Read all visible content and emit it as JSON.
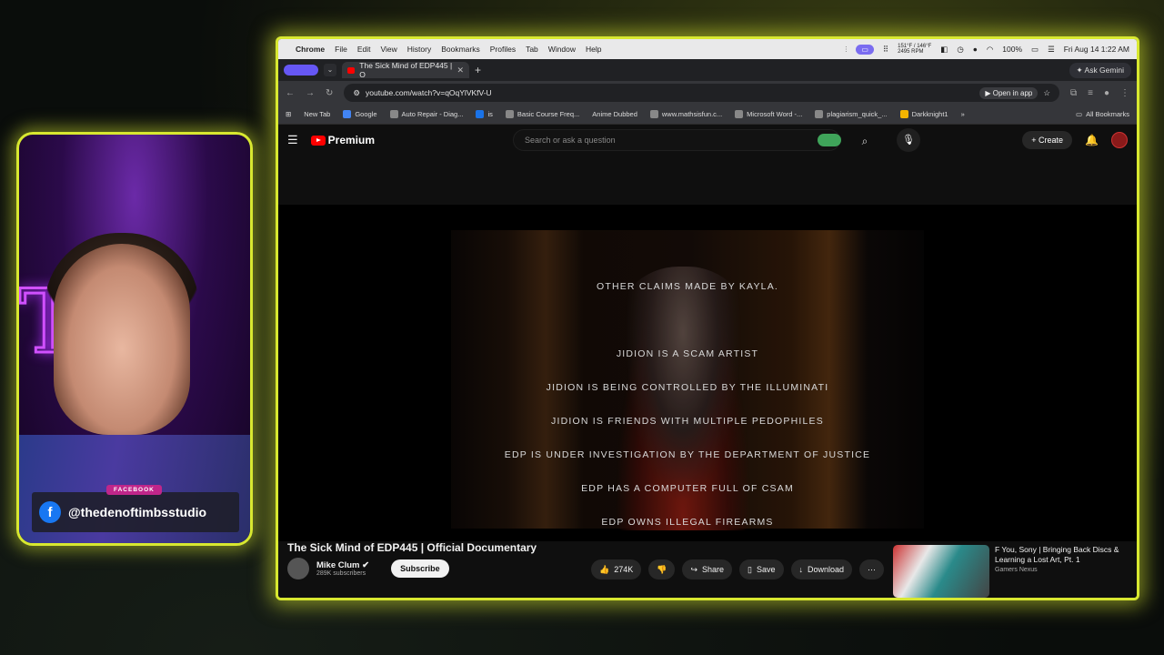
{
  "mac_menu": {
    "app": "Chrome",
    "items": [
      "File",
      "Edit",
      "View",
      "History",
      "Bookmarks",
      "Profiles",
      "Tab",
      "Window",
      "Help"
    ],
    "stats_top": "151°F / 146°F",
    "stats_bottom": "2495 RPM",
    "battery": "100%",
    "datetime": "Fri Aug 14  1:22 AM"
  },
  "tabs": {
    "active_title": "The Sick Mind of EDP445 | O",
    "ask_gemini": "Ask Gemini"
  },
  "address": {
    "url": "youtube.com/watch?v=qOqYlVKfV-U",
    "open_in_app": "Open in app"
  },
  "bookmarks": {
    "items": [
      "New Tab",
      "Google",
      "Auto Repair - Diag...",
      "is",
      "Basic Course Freq...",
      "Anime Dubbed",
      "www.mathsisfun.c...",
      "Microsoft Word -...",
      "plagiarism_quick_...",
      "Darkknight1"
    ],
    "all_label": "All Bookmarks"
  },
  "youtube": {
    "logo_text": "Premium",
    "search_placeholder": "Search or ask a question",
    "create_label": "Create"
  },
  "video": {
    "heading": "OTHER CLAIMS MADE BY KAYLA.",
    "claims": [
      "JIDION IS A SCAM ARTIST",
      "JIDION IS BEING CONTROLLED BY THE ILLUMINATI",
      "JIDION IS FRIENDS WITH MULTIPLE PEDOPHILES",
      "EDP IS UNDER INVESTIGATION BY THE DEPARTMENT OF JUSTICE",
      "EDP HAS A COMPUTER FULL OF CSAM",
      "EDP OWNS ILLEGAL FIREARMS"
    ],
    "title": "The Sick Mind of EDP445 | Official Documentary",
    "channel": "Mike Clum",
    "subscribers": "289K subscribers",
    "subscribe_label": "Subscribe",
    "likes": "274K",
    "share_label": "Share",
    "save_label": "Save",
    "download_label": "Download"
  },
  "related": {
    "title": "F You, Sony | Bringing Back Discs & Learning a Lost Art, Pt. 1",
    "channel": "Gamers Nexus"
  },
  "cam": {
    "tag": "FACEBOOK",
    "handle": "@thedenoftimbsstudio"
  }
}
